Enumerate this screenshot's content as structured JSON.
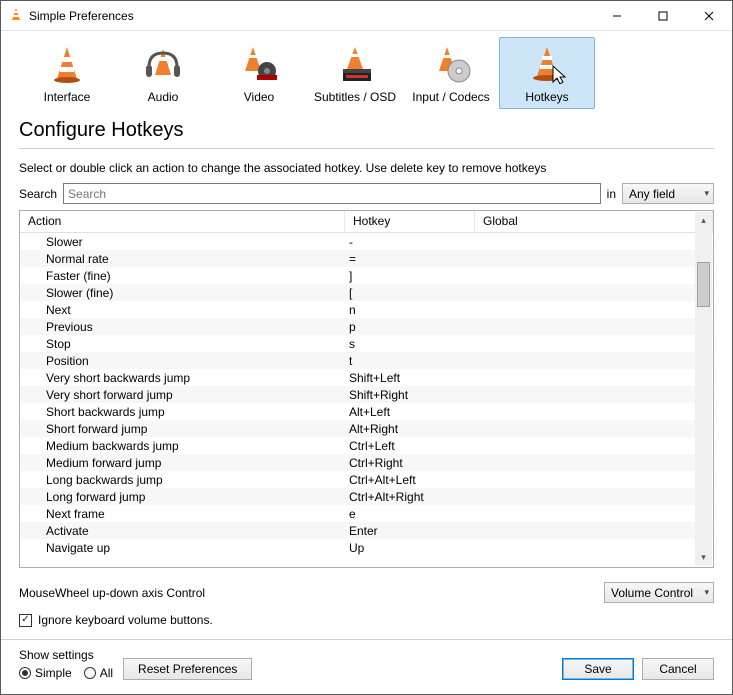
{
  "window": {
    "title": "Simple Preferences"
  },
  "tabs": {
    "items": [
      {
        "label": "Interface"
      },
      {
        "label": "Audio"
      },
      {
        "label": "Video"
      },
      {
        "label": "Subtitles / OSD"
      },
      {
        "label": "Input / Codecs"
      },
      {
        "label": "Hotkeys"
      }
    ],
    "selected_index": 5
  },
  "heading": "Configure Hotkeys",
  "instructions": "Select or double click an action to change the associated hotkey. Use delete key to remove hotkeys",
  "search": {
    "label": "Search",
    "placeholder": "Search",
    "value": "",
    "in_label": "in",
    "field_selected": "Any field"
  },
  "table": {
    "columns": {
      "action": "Action",
      "hotkey": "Hotkey",
      "global": "Global"
    },
    "rows": [
      {
        "action": "Slower",
        "hotkey": "-",
        "global": ""
      },
      {
        "action": "Normal rate",
        "hotkey": "=",
        "global": ""
      },
      {
        "action": "Faster (fine)",
        "hotkey": "]",
        "global": ""
      },
      {
        "action": "Slower (fine)",
        "hotkey": "[",
        "global": ""
      },
      {
        "action": "Next",
        "hotkey": "n",
        "global": ""
      },
      {
        "action": "Previous",
        "hotkey": "p",
        "global": ""
      },
      {
        "action": "Stop",
        "hotkey": "s",
        "global": ""
      },
      {
        "action": "Position",
        "hotkey": "t",
        "global": ""
      },
      {
        "action": "Very short backwards jump",
        "hotkey": "Shift+Left",
        "global": ""
      },
      {
        "action": "Very short forward jump",
        "hotkey": "Shift+Right",
        "global": ""
      },
      {
        "action": "Short backwards jump",
        "hotkey": "Alt+Left",
        "global": ""
      },
      {
        "action": "Short forward jump",
        "hotkey": "Alt+Right",
        "global": ""
      },
      {
        "action": "Medium backwards jump",
        "hotkey": "Ctrl+Left",
        "global": ""
      },
      {
        "action": "Medium forward jump",
        "hotkey": "Ctrl+Right",
        "global": ""
      },
      {
        "action": "Long backwards jump",
        "hotkey": "Ctrl+Alt+Left",
        "global": ""
      },
      {
        "action": "Long forward jump",
        "hotkey": "Ctrl+Alt+Right",
        "global": ""
      },
      {
        "action": "Next frame",
        "hotkey": "e",
        "global": ""
      },
      {
        "action": "Activate",
        "hotkey": "Enter",
        "global": ""
      },
      {
        "action": "Navigate up",
        "hotkey": "Up",
        "global": ""
      }
    ]
  },
  "mousewheel": {
    "label": "MouseWheel up-down axis Control",
    "selected": "Volume Control"
  },
  "ignore_kb_volume": {
    "checked": true,
    "label": "Ignore keyboard volume buttons."
  },
  "show_settings": {
    "label": "Show settings",
    "options": {
      "simple": "Simple",
      "all": "All"
    },
    "selected": "simple"
  },
  "buttons": {
    "reset": "Reset Preferences",
    "save": "Save",
    "cancel": "Cancel"
  }
}
